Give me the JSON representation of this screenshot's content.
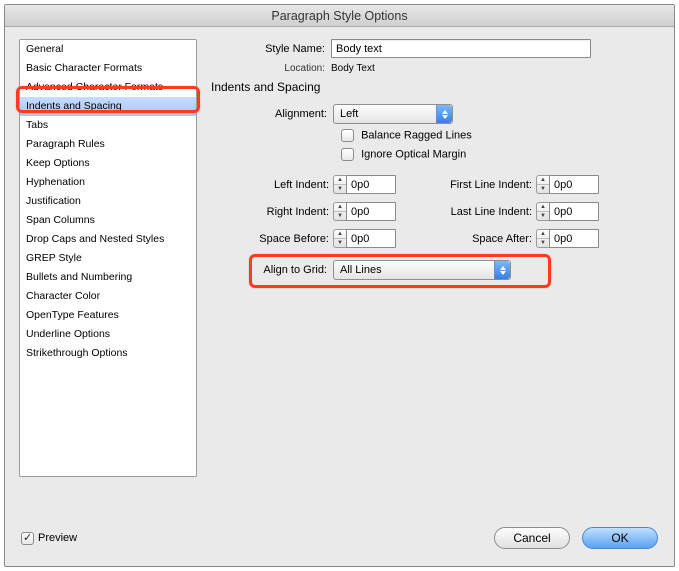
{
  "title": "Paragraph Style Options",
  "sidebar": {
    "items": [
      "General",
      "Basic Character Formats",
      "Advanced Character Formats",
      "Indents and Spacing",
      "Tabs",
      "Paragraph Rules",
      "Keep Options",
      "Hyphenation",
      "Justification",
      "Span Columns",
      "Drop Caps and Nested Styles",
      "GREP Style",
      "Bullets and Numbering",
      "Character Color",
      "OpenType Features",
      "Underline Options",
      "Strikethrough Options"
    ],
    "selected_index": 3
  },
  "form": {
    "style_name_label": "Style Name:",
    "style_name_value": "Body text",
    "location_label": "Location:",
    "location_value": "Body Text",
    "section_title": "Indents and Spacing",
    "alignment_label": "Alignment:",
    "alignment_value": "Left",
    "balance_label": "Balance Ragged Lines",
    "ignore_label": "Ignore Optical Margin",
    "left_indent_label": "Left Indent:",
    "left_indent_value": "0p0",
    "first_line_label": "First Line Indent:",
    "first_line_value": "0p0",
    "right_indent_label": "Right Indent:",
    "right_indent_value": "0p0",
    "last_line_label": "Last Line Indent:",
    "last_line_value": "0p0",
    "space_before_label": "Space Before:",
    "space_before_value": "0p0",
    "space_after_label": "Space After:",
    "space_after_value": "0p0",
    "align_grid_label": "Align to Grid:",
    "align_grid_value": "All Lines"
  },
  "footer": {
    "preview_label": "Preview",
    "cancel": "Cancel",
    "ok": "OK"
  }
}
